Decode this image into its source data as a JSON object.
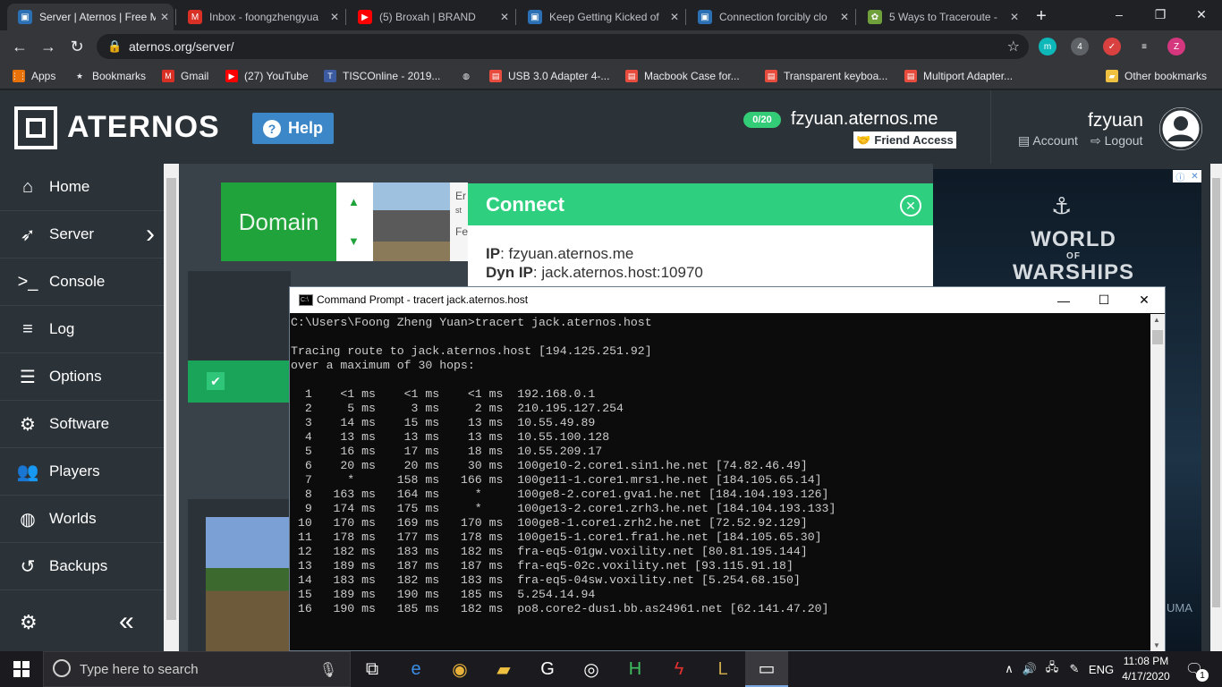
{
  "browser": {
    "tabs": [
      {
        "title": "Server | Aternos | Free M",
        "icon": "aternos-icon",
        "color": "#2b6fb4",
        "active": true
      },
      {
        "title": "Inbox - foongzhengyua",
        "icon": "gmail-icon",
        "color": "#d93025"
      },
      {
        "title": "(5) Broxah | BRAND",
        "icon": "youtube-icon",
        "color": "#ff0000"
      },
      {
        "title": "Keep Getting Kicked of",
        "icon": "aternos-icon",
        "color": "#2b6fb4"
      },
      {
        "title": "Connection forcibly clo",
        "icon": "aternos-icon",
        "color": "#2b6fb4"
      },
      {
        "title": "5 Ways to Traceroute - ",
        "icon": "wikihow-icon",
        "color": "#6fa03c"
      }
    ],
    "new_tab": "+",
    "window_controls": {
      "minimize": "–",
      "restore": "❐",
      "close": "✕"
    },
    "url": "aternos.org/server/",
    "nav": {
      "back": "←",
      "forward": "→",
      "reload": "↻"
    },
    "extensions": [
      {
        "label": "m",
        "color": "#0fb8b8"
      },
      {
        "label": "4",
        "color": "#5f6368"
      },
      {
        "label": "✓",
        "color": "#d94040"
      },
      {
        "label": "≡",
        "color": "#35363a"
      },
      {
        "label": "Z",
        "color": "#d4377e"
      }
    ],
    "bookmarks": [
      {
        "label": "Apps",
        "icon": "apps-grid-icon",
        "color": "#e8710a"
      },
      {
        "label": "Bookmarks",
        "icon": "star-icon",
        "color": "#e8eaed"
      },
      {
        "label": "Gmail",
        "icon": "gmail-icon",
        "color": "#d93025"
      },
      {
        "label": "(27) YouTube",
        "icon": "youtube-icon",
        "color": "#ff0000"
      },
      {
        "label": "TISCOnline - 2019...",
        "icon": "tisc-icon",
        "color": "#3c5aa0"
      },
      {
        "label": "",
        "icon": "globe-icon",
        "color": "#e8eaed"
      },
      {
        "label": "USB 3.0 Adapter 4-...",
        "icon": "shopping-bag-icon",
        "color": "#e74c3c"
      },
      {
        "label": "Macbook Case for...",
        "icon": "shopping-bag-icon",
        "color": "#e74c3c"
      },
      {
        "label": "Transparent keyboa...",
        "icon": "shopping-bag-icon",
        "color": "#e74c3c"
      },
      {
        "label": "Multiport Adapter...",
        "icon": "shopping-bag-icon",
        "color": "#e74c3c"
      },
      {
        "label": "Other bookmarks",
        "icon": "folder-icon",
        "color": "#f0c040"
      }
    ]
  },
  "aternos": {
    "logo_text": "ATERNOS",
    "help_label": "Help",
    "players_badge": "0/20",
    "server_address": "fzyuan.aternos.me",
    "friend_access": "Friend Access",
    "username": "fzyuan",
    "account_label": "Account",
    "logout_label": "Logout",
    "sidebar": [
      {
        "label": "Home",
        "icon": "home-icon",
        "glyph": "⌂"
      },
      {
        "label": "Server",
        "icon": "rocket-icon",
        "glyph": "➶"
      },
      {
        "label": "Console",
        "icon": "terminal-icon",
        "glyph": ">_"
      },
      {
        "label": "Log",
        "icon": "log-lines-icon",
        "glyph": "≡"
      },
      {
        "label": "Options",
        "icon": "sliders-icon",
        "glyph": "☰"
      },
      {
        "label": "Software",
        "icon": "gears-icon",
        "glyph": "⚙"
      },
      {
        "label": "Players",
        "icon": "users-icon",
        "glyph": "👥"
      },
      {
        "label": "Worlds",
        "icon": "globe-icon",
        "glyph": "◍"
      },
      {
        "label": "Backups",
        "icon": "backup-icon",
        "glyph": "↺"
      }
    ],
    "ad_domain_text": "Domain",
    "ad_text_snippets": [
      "Er",
      "st",
      "Fe"
    ],
    "connect": {
      "title": "Connect",
      "ip_label": "IP",
      "ip_value": "fzyuan.aternos.me",
      "dyn_label": "Dyn IP",
      "dyn_value": "jack.aternos.host:10970"
    },
    "right_ad": {
      "title_line1": "WORLD",
      "title_line2": "OF",
      "title_line3": "WARSHIPS",
      "footer": "UMA"
    }
  },
  "cmd": {
    "title": "Command Prompt - tracert  jack.aternos.host",
    "lines": [
      "C:\\Users\\Foong Zheng Yuan>tracert jack.aternos.host",
      "",
      "Tracing route to jack.aternos.host [194.125.251.92]",
      "over a maximum of 30 hops:",
      "",
      "  1    <1 ms    <1 ms    <1 ms  192.168.0.1",
      "  2     5 ms     3 ms     2 ms  210.195.127.254",
      "  3    14 ms    15 ms    13 ms  10.55.49.89",
      "  4    13 ms    13 ms    13 ms  10.55.100.128",
      "  5    16 ms    17 ms    18 ms  10.55.209.17",
      "  6    20 ms    20 ms    30 ms  100ge10-2.core1.sin1.he.net [74.82.46.49]",
      "  7     *      158 ms   166 ms  100ge11-1.core1.mrs1.he.net [184.105.65.14]",
      "  8   163 ms   164 ms     *     100ge8-2.core1.gva1.he.net [184.104.193.126]",
      "  9   174 ms   175 ms     *     100ge13-2.core1.zrh3.he.net [184.104.193.133]",
      " 10   170 ms   169 ms   170 ms  100ge8-1.core1.zrh2.he.net [72.52.92.129]",
      " 11   178 ms   177 ms   178 ms  100ge15-1.core1.fra1.he.net [184.105.65.30]",
      " 12   182 ms   183 ms   182 ms  fra-eq5-01gw.voxility.net [80.81.195.144]",
      " 13   189 ms   187 ms   187 ms  fra-eq5-02c.voxility.net [93.115.91.18]",
      " 14   183 ms   182 ms   183 ms  fra-eq5-04sw.voxility.net [5.254.68.150]",
      " 15   189 ms   190 ms   185 ms  5.254.14.94",
      " 16   190 ms   185 ms   182 ms  po8.core2-dus1.bb.as24961.net [62.141.47.20]"
    ]
  },
  "taskbar": {
    "search_placeholder": "Type here to search",
    "language": "ENG",
    "time": "11:08 PM",
    "date": "4/17/2020",
    "notification_count": "1",
    "apps": [
      "task-view-icon",
      "edge-icon",
      "chrome-icon",
      "file-explorer-icon",
      "epic-games-icon",
      "steam-icon",
      "h-app-icon",
      "flash-app-icon",
      "league-of-legends-icon",
      "command-prompt-icon"
    ]
  }
}
